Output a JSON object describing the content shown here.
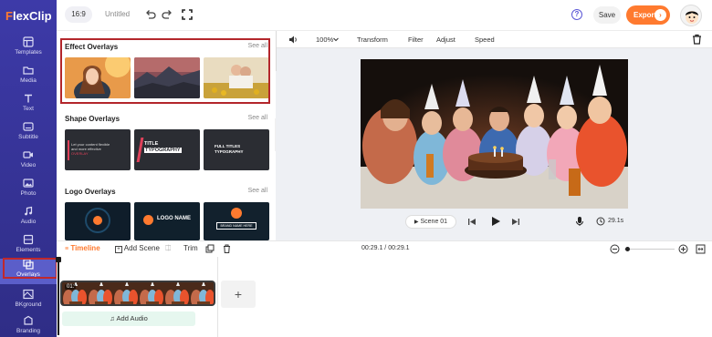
{
  "app": {
    "name": "FlexClip",
    "logo_initial": "F",
    "logo_rest": "lexClip"
  },
  "topbar": {
    "ratio": "16:9",
    "title": "Untitled",
    "help_label": "?",
    "save_label": "Save",
    "export_label": "Export",
    "export_chevron": "›"
  },
  "sidebar": {
    "items": [
      {
        "label": "Templates",
        "icon": "templates-icon"
      },
      {
        "label": "Media",
        "icon": "folder-icon"
      },
      {
        "label": "Text",
        "icon": "text-icon"
      },
      {
        "label": "Subtitle",
        "icon": "subtitle-icon"
      },
      {
        "label": "Video",
        "icon": "video-icon"
      },
      {
        "label": "Photo",
        "icon": "photo-icon"
      },
      {
        "label": "Audio",
        "icon": "music-icon"
      },
      {
        "label": "Elements",
        "icon": "elements-icon"
      },
      {
        "label": "Overlays",
        "icon": "overlays-icon",
        "active": true
      },
      {
        "label": "BKground",
        "icon": "background-icon"
      },
      {
        "label": "Branding",
        "icon": "branding-icon"
      }
    ]
  },
  "panel": {
    "sections": [
      {
        "title": "Effect Overlays",
        "see_all": "See all"
      },
      {
        "title": "Shape Overlays",
        "see_all": "See all",
        "thumbs": [
          {
            "line1": "Let your content flexible",
            "line2": "and more effective",
            "tag": "OVERLAY"
          },
          {
            "line1": "TITLE",
            "line2": "TYPOGRAPHY"
          },
          {
            "line1": "FULL TITLES",
            "line2": "TYPOGRAPHY"
          }
        ]
      },
      {
        "title": "Logo Overlays",
        "see_all": "See all",
        "thumbs": [
          {
            "text": ""
          },
          {
            "text": "LOGO NAME"
          },
          {
            "text": "BRAND NAME HERE"
          }
        ]
      }
    ],
    "collapse_glyph": "‹"
  },
  "editor": {
    "zoom": "100%",
    "tools": [
      "Transform",
      "Filter",
      "Adjust",
      "Speed"
    ],
    "scene_label": "Scene 01",
    "duration": "29.1s"
  },
  "timeline": {
    "tab_label": "Timeline",
    "add_scene": "Add Scene",
    "trim": "Trim",
    "time": "00:29.1 / 00:29.1",
    "zoom_level": 0.07,
    "clip_duration": "01:",
    "add_audio": "Add Audio",
    "add_clip": "+"
  },
  "colors": {
    "accent": "#ff7a2f",
    "nav_bg": "#3d3aa8",
    "highlight": "#b3262b",
    "primary": "#5a56d6"
  }
}
